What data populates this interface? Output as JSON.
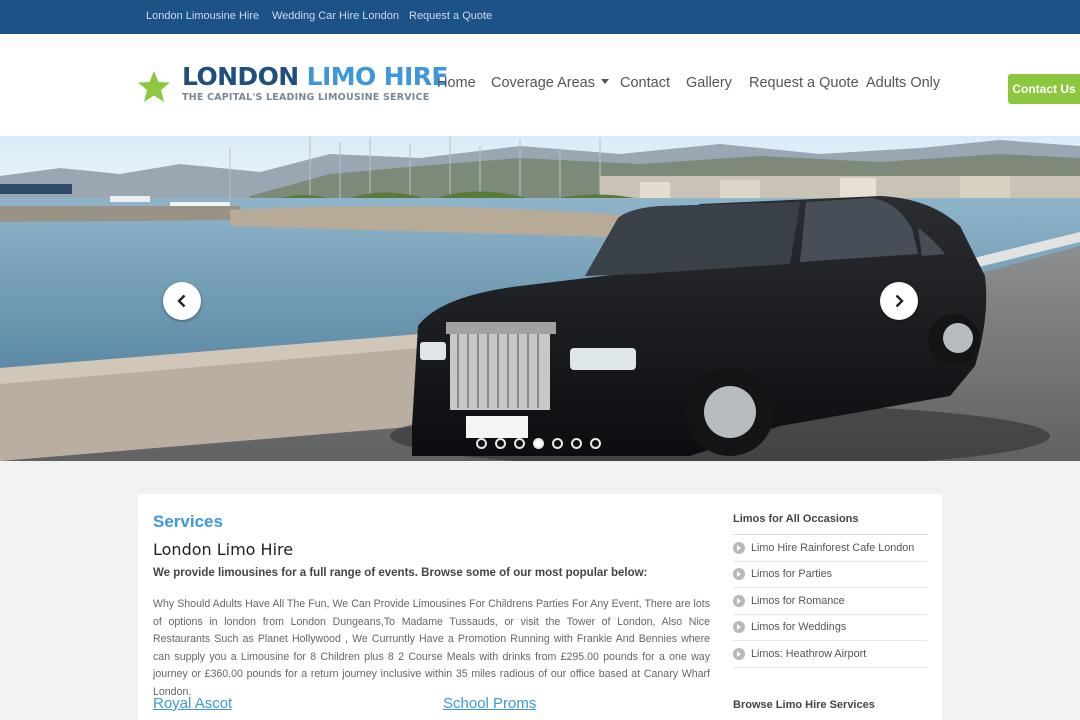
{
  "topbar": {
    "links": [
      "London Limousine Hire",
      "Wedding Car Hire London",
      "Request a Quote"
    ]
  },
  "logo": {
    "title_part1": "LONDON",
    "title_part2": "LIMO HIRE",
    "tagline": "THE CAPITAL'S LEADING LIMOUSINE SERVICE"
  },
  "nav": {
    "items": [
      "Home",
      "Coverage Areas",
      "Contact",
      "Gallery",
      "Request a Quote",
      "Adults Only"
    ]
  },
  "contact_button": "Contact Us",
  "slider": {
    "slide_count": 7,
    "active_slide": 4,
    "icons": {
      "prev": "chevron-left-icon",
      "next": "chevron-right-icon"
    }
  },
  "services": {
    "heading": "Services",
    "title": "London Limo Hire",
    "lead": "We provide limousines for a full range of events. Browse some of our most popular below:",
    "body": "Why Should Adults Have All The Fun, We Can Provide Limousines For Childrens Parties For Any Event, There are lots of options in london from London Dungeans,To Madame Tussauds, or visit the Tower of London, Also Nice Restaurants Such as Planet Hollywood , We Curruntly Have a Promotion Running with Frankie And Bennies where can supply you a Limousine for 8 Children plus 8 2 Course Meals with drinks from £295.00 pounds for a one way journey or £360.00 pounds for a return journey inclusive within 35 miles radious of our office based at Canary Wharf London.",
    "sub_headings": [
      "Royal Ascot",
      "School Proms"
    ]
  },
  "sidebar": {
    "heading": "Limos for All Occasions",
    "items": [
      "Limo Hire Rainforest Cafe London",
      "Limos for Parties",
      "Limos for Romance",
      "Limos for Weddings",
      "Limos: Heathrow Airport"
    ],
    "heading2": "Browse Limo Hire Services"
  },
  "colors": {
    "topbar": "#1d5287",
    "accent_blue": "#3e97db",
    "contact_green": "#8dc63f",
    "logo_star": "#8dc63f"
  }
}
